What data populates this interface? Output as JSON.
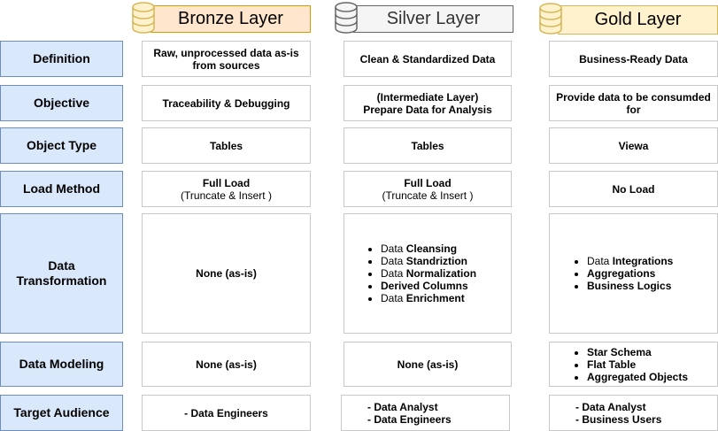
{
  "layers": {
    "bronze": {
      "title": "Bronze Layer",
      "color": "#fff2cc",
      "header_color": "#ffe6cc"
    },
    "silver": {
      "title": "Silver Layer",
      "color": "#f5f5f5"
    },
    "gold": {
      "title": "Gold Layer",
      "color": "#fff2cc"
    }
  },
  "rows": {
    "definition": {
      "label": "Definition",
      "bronze": [
        "Raw, unprocessed data as-is",
        "from sources"
      ],
      "silver": "Clean & Standardized Data",
      "gold": "Business-Ready Data"
    },
    "objective": {
      "label": "Objective",
      "bronze": "Traceability & Debugging",
      "silver": [
        "(Intermediate Layer)",
        "Prepare Data for Analysis"
      ],
      "gold": [
        "Provide data to be consumded",
        "for"
      ]
    },
    "object_type": {
      "label": "Object Type",
      "bronze": "Tables",
      "silver": "Tables",
      "gold": "Viewa"
    },
    "load_method": {
      "label": "Load Method",
      "bronze": [
        "Full Load",
        "(Truncate & Insert )"
      ],
      "silver": [
        "Full Load",
        "(Truncate & Insert )"
      ],
      "gold": "No Load"
    },
    "data_transformation": {
      "label": [
        "Data",
        "Transformation"
      ],
      "bronze": "None (as-is)",
      "silver": [
        {
          "prefix": "Data ",
          "main": "Cleansing"
        },
        {
          "prefix": "Data ",
          "main": "Standriztion"
        },
        {
          "prefix": "Data ",
          "main": "Normalization"
        },
        {
          "prefix": "",
          "main": "Derived Columns"
        },
        {
          "prefix": "Data ",
          "main": "Enrichment"
        }
      ],
      "gold": [
        {
          "prefix": "Data ",
          "main": "Integrations"
        },
        {
          "prefix": "",
          "main": "Aggregations"
        },
        {
          "prefix": "",
          "main": "Business Logics"
        }
      ]
    },
    "data_modeling": {
      "label": "Data Modeling",
      "bronze": "None (as-is)",
      "silver": "None (as-is)",
      "gold": [
        "Star Schema",
        "Flat Table",
        "Aggregated Objects"
      ]
    },
    "target_audience": {
      "label": "Target Audience",
      "bronze": "- Data Engineers",
      "silver": [
        "- Data Analyst",
        "- Data Engineers"
      ],
      "gold": [
        "- Data Analyst",
        "- Business Users"
      ]
    }
  }
}
